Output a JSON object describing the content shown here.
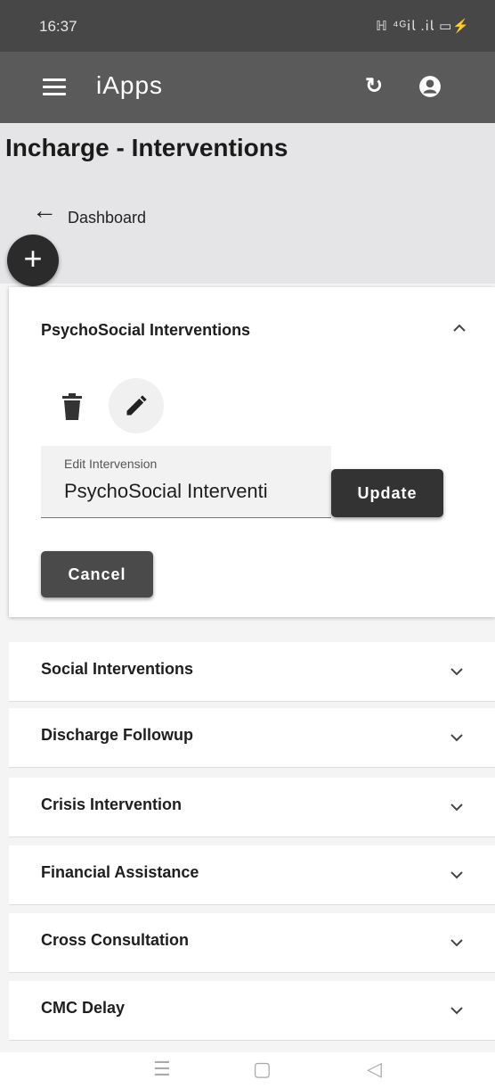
{
  "status_bar": {
    "time": "16:37",
    "indicators": "ℍ ⁴ᴳ𝗂𝗅 .𝗂𝗅 ▭⚡"
  },
  "app_bar": {
    "title": "iApps",
    "menu_icon": "hamburger-menu-icon",
    "refresh_icon": "refresh-icon",
    "account_icon": "account-circle-icon"
  },
  "page": {
    "title": "Incharge - Interventions",
    "back_label": "Dashboard",
    "fab_label": "+"
  },
  "expanded_panel": {
    "title": "PsychoSocial Interventions",
    "edit_field": {
      "label": "Edit Intervension",
      "value": "PsychoSocial Interventi"
    },
    "update_label": "Update",
    "cancel_label": "Cancel"
  },
  "panels": [
    {
      "title": "Social Interventions"
    },
    {
      "title": "Discharge Followup"
    },
    {
      "title": "Crisis Intervention"
    },
    {
      "title": "Financial Assistance"
    },
    {
      "title": "Cross Consultation"
    },
    {
      "title": "CMC Delay"
    }
  ],
  "nav_bar": {
    "menu": "☰",
    "home": "▢",
    "back": "◁"
  },
  "colors": {
    "app_bar": "#5a5a5a",
    "status_bar": "#474747",
    "button": "#333333",
    "page_bg": "#e5e5e7"
  }
}
